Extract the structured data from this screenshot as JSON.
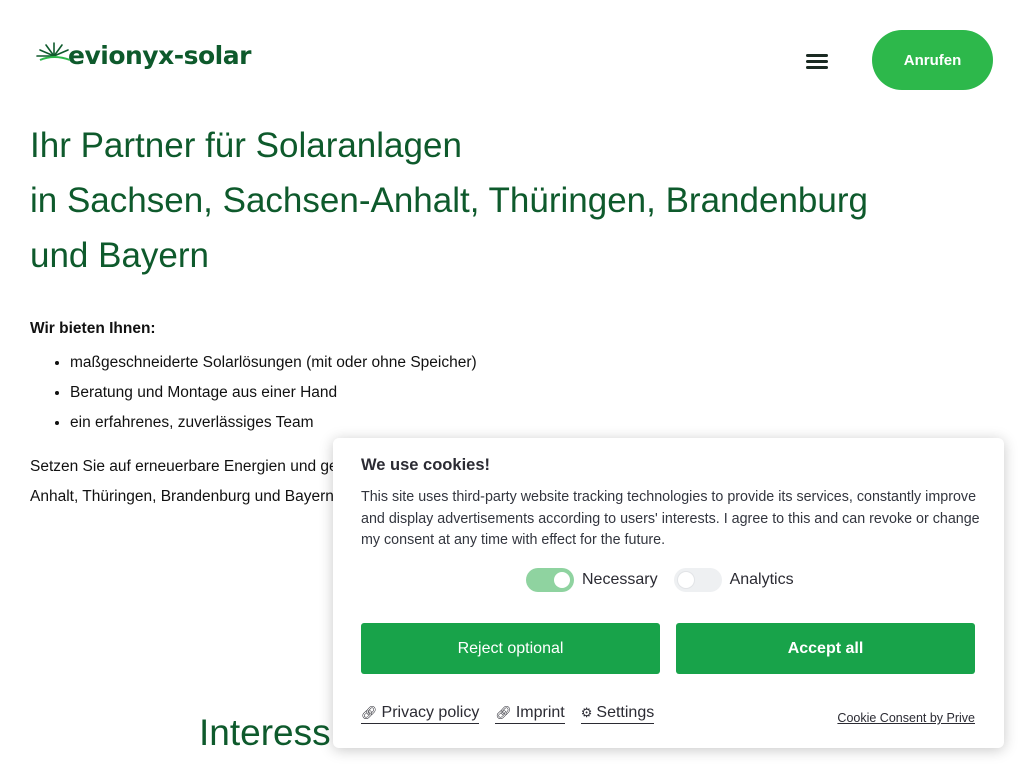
{
  "header": {
    "logo_text": "evionyx-solar",
    "menu_icon": "hamburger-menu-icon",
    "call_label": "Anrufen"
  },
  "hero": {
    "line1": "Ihr Partner für Solaranlagen",
    "line2": "in Sachsen, Sachsen-Anhalt, Thüringen, Brandenburg",
    "line3": "und Bayern"
  },
  "offer": {
    "heading": "Wir bieten Ihnen:",
    "items": [
      "maßgeschneiderte Solarlösungen (mit oder ohne Speicher)",
      "Beratung und Montage aus einer Hand",
      "ein erfahrenes, zuverlässiges Team"
    ]
  },
  "paragraph": {
    "line1": "Setzen Sie auf erneuerbare Energien und ge",
    "line2": "Anhalt, Thüringen, Brandenburg und Bayern"
  },
  "interest": {
    "heading": "Interess"
  },
  "cookie": {
    "title": "We use cookies!",
    "text": "This site uses third-party website tracking technologies to provide its services, constantly improve and display advertisements according to users' interests. I agree to this and can revoke or change my consent at any time with effect for the future.",
    "necessary_label": "Necessary",
    "necessary_on": true,
    "analytics_label": "Analytics",
    "analytics_on": false,
    "reject_label": "Reject optional",
    "accept_label": "Accept all",
    "privacy_label": "Privacy policy",
    "imprint_label": "Imprint",
    "settings_label": "Settings",
    "prive_label": "Cookie Consent by Prive"
  },
  "colors": {
    "brand_green": "#0e5a2c",
    "accent_green": "#2db84b",
    "button_green": "#18a34a"
  }
}
